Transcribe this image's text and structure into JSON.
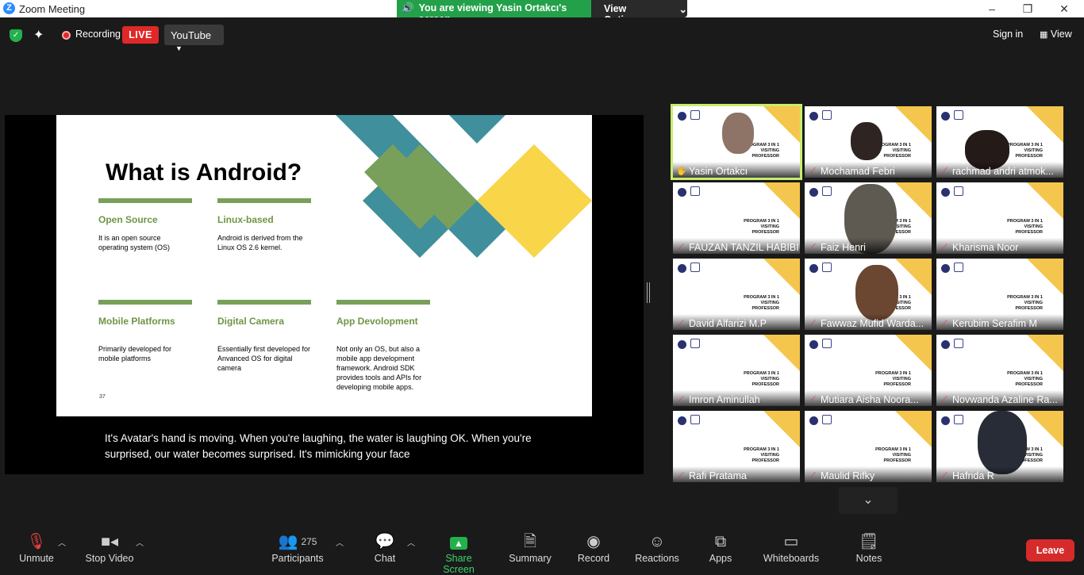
{
  "window": {
    "title": "Zoom Meeting",
    "min_icon": "minimize-icon",
    "max_icon": "maximize-icon",
    "close_icon": "close-icon"
  },
  "banner": {
    "message": "You are viewing Yasin Ortakcı's screen",
    "view_options": "View Options"
  },
  "topbar": {
    "recording": "Recording",
    "live": "LIVE",
    "stream": "YouTube",
    "sign_in": "Sign in",
    "view": "View"
  },
  "slide": {
    "title": "What is Android?",
    "page": "37",
    "columns": [
      {
        "heading": "Open Source",
        "text": "It is an open source operating system (OS)"
      },
      {
        "heading": "Linux-based",
        "text": "Android is derived from the Linux OS 2.6 kernel."
      },
      {
        "heading": "Mobile Platforms",
        "text": "Primarily developed for mobile platforms"
      },
      {
        "heading": "Digital Camera",
        "text": "Essentially first developed for Anvanced OS for digital camera"
      },
      {
        "heading": "App Devolopment",
        "text": "Not only an OS, but also a mobile app development framework. Android SDK provides tools and APIs for developing mobile apps."
      }
    ],
    "colors": {
      "green": "#79a05a",
      "yellow": "#f8d549",
      "teal": "#3f8f9c"
    }
  },
  "caption": "It's Avatar's hand is moving. When you're laughing, the water is laughing OK. When you're surprised, our water becomes surprised. It's mimicking your face",
  "tile_program_text": "PROGRAM 3 IN 1 VISITING PROFESSOR",
  "participants": [
    {
      "name": "Yasin Ortakcı",
      "active": true,
      "video": true
    },
    {
      "name": "Mochamad Febri",
      "active": false,
      "video": true
    },
    {
      "name": "rachmad andri atmok...",
      "active": false,
      "video": true
    },
    {
      "name": "FAUZAN TANZIL HABIBI",
      "active": false,
      "video": false
    },
    {
      "name": "Faiz Henri",
      "active": false,
      "video": true
    },
    {
      "name": "Kharisma Noor",
      "active": false,
      "video": false
    },
    {
      "name": "David Alfarizi M.P",
      "active": false,
      "video": false
    },
    {
      "name": "Fawwaz Mufid Warda...",
      "active": false,
      "video": true
    },
    {
      "name": "Kerubim Serafim M",
      "active": false,
      "video": false
    },
    {
      "name": "Imron Aminullah",
      "active": false,
      "video": false
    },
    {
      "name": "Mutiara Aisha Noora...",
      "active": false,
      "video": false
    },
    {
      "name": "Novwanda Azaline Ra...",
      "active": false,
      "video": false
    },
    {
      "name": "Rafi Pratama",
      "active": false,
      "video": false
    },
    {
      "name": "Maulid Rifky",
      "active": false,
      "video": false
    },
    {
      "name": "Hafrida R",
      "active": false,
      "video": true
    }
  ],
  "toolbar": {
    "unmute": "Unmute",
    "stop_video": "Stop Video",
    "participants": "Participants",
    "participant_count": "275",
    "chat": "Chat",
    "share_screen": "Share Screen",
    "summary": "Summary",
    "record": "Record",
    "reactions": "Reactions",
    "apps": "Apps",
    "whiteboards": "Whiteboards",
    "notes": "Notes",
    "leave": "Leave"
  }
}
